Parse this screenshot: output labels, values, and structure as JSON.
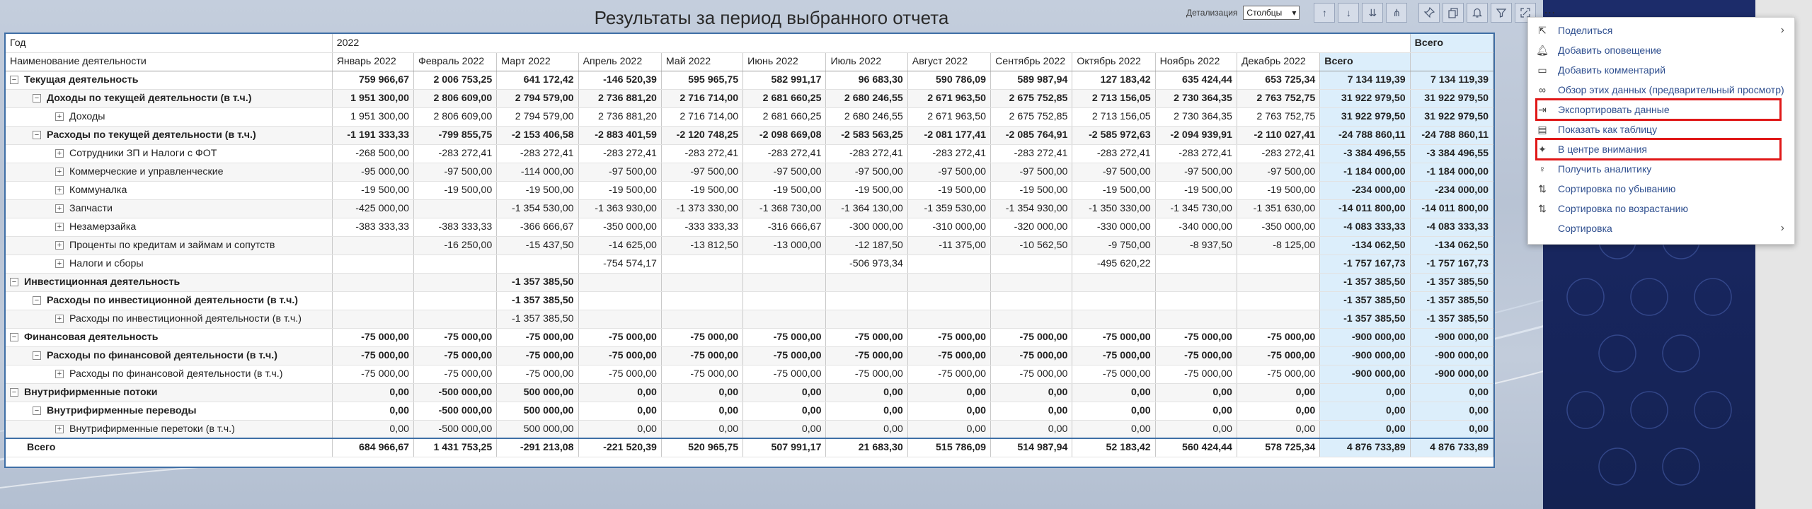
{
  "report": {
    "title": "Результаты за период выбранного отчета",
    "detail_label": "Детализация",
    "detail_value": "Столбцы"
  },
  "table": {
    "year_label": "Год",
    "year_value": "2022",
    "name_header": "Наименование деятельности",
    "total_header": "Всего",
    "total_header_outer": "Всего",
    "months": [
      "Январь 2022",
      "Февраль 2022",
      "Март 2022",
      "Апрель 2022",
      "Май 2022",
      "Июнь 2022",
      "Июль 2022",
      "Август 2022",
      "Сентябрь 2022",
      "Октябрь 2022",
      "Ноябрь 2022",
      "Декабрь 2022"
    ],
    "rows": [
      {
        "name": "Текущая деятельность",
        "level": 0,
        "bold": true,
        "toggle": "−",
        "values": [
          "759 966,67",
          "2 006 753,25",
          "641 172,42",
          "-146 520,39",
          "595 965,75",
          "582 991,17",
          "96 683,30",
          "590 786,09",
          "589 987,94",
          "127 183,42",
          "635 424,44",
          "653 725,34"
        ],
        "total": "7 134 119,39",
        "total2": "7 134 119,39"
      },
      {
        "name": "Доходы по текущей деятельности (в т.ч.)",
        "level": 1,
        "bold": true,
        "toggle": "−",
        "values": [
          "1 951 300,00",
          "2 806 609,00",
          "2 794 579,00",
          "2 736 881,20",
          "2 716 714,00",
          "2 681 660,25",
          "2 680 246,55",
          "2 671 963,50",
          "2 675 752,85",
          "2 713 156,05",
          "2 730 364,35",
          "2 763 752,75"
        ],
        "total": "31 922 979,50",
        "total2": "31 922 979,50"
      },
      {
        "name": "Доходы",
        "level": 2,
        "bold": false,
        "toggle": "+",
        "values": [
          "1 951 300,00",
          "2 806 609,00",
          "2 794 579,00",
          "2 736 881,20",
          "2 716 714,00",
          "2 681 660,25",
          "2 680 246,55",
          "2 671 963,50",
          "2 675 752,85",
          "2 713 156,05",
          "2 730 364,35",
          "2 763 752,75"
        ],
        "total": "31 922 979,50",
        "total2": "31 922 979,50"
      },
      {
        "name": "Расходы по текущей деятельности (в т.ч.)",
        "level": 1,
        "bold": true,
        "toggle": "−",
        "values": [
          "-1 191 333,33",
          "-799 855,75",
          "-2 153 406,58",
          "-2 883 401,59",
          "-2 120 748,25",
          "-2 098 669,08",
          "-2 583 563,25",
          "-2 081 177,41",
          "-2 085 764,91",
          "-2 585 972,63",
          "-2 094 939,91",
          "-2 110 027,41"
        ],
        "total": "-24 788 860,11",
        "total2": "-24 788 860,11"
      },
      {
        "name": "Сотрудники ЗП и Налоги с ФОТ",
        "level": 2,
        "bold": false,
        "toggle": "+",
        "values": [
          "-268 500,00",
          "-283 272,41",
          "-283 272,41",
          "-283 272,41",
          "-283 272,41",
          "-283 272,41",
          "-283 272,41",
          "-283 272,41",
          "-283 272,41",
          "-283 272,41",
          "-283 272,41",
          "-283 272,41"
        ],
        "total": "-3 384 496,55",
        "total2": "-3 384 496,55"
      },
      {
        "name": "Коммерческие и управленческие",
        "level": 2,
        "bold": false,
        "toggle": "+",
        "values": [
          "-95 000,00",
          "-97 500,00",
          "-114 000,00",
          "-97 500,00",
          "-97 500,00",
          "-97 500,00",
          "-97 500,00",
          "-97 500,00",
          "-97 500,00",
          "-97 500,00",
          "-97 500,00",
          "-97 500,00"
        ],
        "total": "-1 184 000,00",
        "total2": "-1 184 000,00"
      },
      {
        "name": "Коммуналка",
        "level": 2,
        "bold": false,
        "toggle": "+",
        "values": [
          "-19 500,00",
          "-19 500,00",
          "-19 500,00",
          "-19 500,00",
          "-19 500,00",
          "-19 500,00",
          "-19 500,00",
          "-19 500,00",
          "-19 500,00",
          "-19 500,00",
          "-19 500,00",
          "-19 500,00"
        ],
        "total": "-234 000,00",
        "total2": "-234 000,00"
      },
      {
        "name": "Запчасти",
        "level": 2,
        "bold": false,
        "toggle": "+",
        "values": [
          "-425 000,00",
          "",
          "-1 354 530,00",
          "-1 363 930,00",
          "-1 373 330,00",
          "-1 368 730,00",
          "-1 364 130,00",
          "-1 359 530,00",
          "-1 354 930,00",
          "-1 350 330,00",
          "-1 345 730,00",
          "-1 351 630,00"
        ],
        "total": "-14 011 800,00",
        "total2": "-14 011 800,00"
      },
      {
        "name": "Незамерзайка",
        "level": 2,
        "bold": false,
        "toggle": "+",
        "values": [
          "-383 333,33",
          "-383 333,33",
          "-366 666,67",
          "-350 000,00",
          "-333 333,33",
          "-316 666,67",
          "-300 000,00",
          "-310 000,00",
          "-320 000,00",
          "-330 000,00",
          "-340 000,00",
          "-350 000,00"
        ],
        "total": "-4 083 333,33",
        "total2": "-4 083 333,33"
      },
      {
        "name": "Проценты по кредитам и займам и сопутств",
        "level": 2,
        "bold": false,
        "toggle": "+",
        "values": [
          "",
          "-16 250,00",
          "-15 437,50",
          "-14 625,00",
          "-13 812,50",
          "-13 000,00",
          "-12 187,50",
          "-11 375,00",
          "-10 562,50",
          "-9 750,00",
          "-8 937,50",
          "-8 125,00"
        ],
        "total": "-134 062,50",
        "total2": "-134 062,50"
      },
      {
        "name": "Налоги и сборы",
        "level": 2,
        "bold": false,
        "toggle": "+",
        "values": [
          "",
          "",
          "",
          "-754 574,17",
          "",
          "",
          "-506 973,34",
          "",
          "",
          "-495 620,22",
          "",
          ""
        ],
        "total": "-1 757 167,73",
        "total2": "-1 757 167,73"
      },
      {
        "name": "Инвестиционная деятельность",
        "level": 0,
        "bold": true,
        "toggle": "−",
        "values": [
          "",
          "",
          "-1 357 385,50",
          "",
          "",
          "",
          "",
          "",
          "",
          "",
          "",
          ""
        ],
        "total": "-1 357 385,50",
        "total2": "-1 357 385,50"
      },
      {
        "name": "Расходы по инвестиционной деятельности (в т.ч.)",
        "level": 1,
        "bold": true,
        "toggle": "−",
        "values": [
          "",
          "",
          "-1 357 385,50",
          "",
          "",
          "",
          "",
          "",
          "",
          "",
          "",
          ""
        ],
        "total": "-1 357 385,50",
        "total2": "-1 357 385,50"
      },
      {
        "name": "Расходы по инвестиционной деятельности (в т.ч.)",
        "level": 2,
        "bold": false,
        "toggle": "+",
        "values": [
          "",
          "",
          "-1 357 385,50",
          "",
          "",
          "",
          "",
          "",
          "",
          "",
          "",
          ""
        ],
        "total": "-1 357 385,50",
        "total2": "-1 357 385,50"
      },
      {
        "name": "Финансовая деятельность",
        "level": 0,
        "bold": true,
        "toggle": "−",
        "values": [
          "-75 000,00",
          "-75 000,00",
          "-75 000,00",
          "-75 000,00",
          "-75 000,00",
          "-75 000,00",
          "-75 000,00",
          "-75 000,00",
          "-75 000,00",
          "-75 000,00",
          "-75 000,00",
          "-75 000,00"
        ],
        "total": "-900 000,00",
        "total2": "-900 000,00"
      },
      {
        "name": "Расходы по финансовой деятельности (в т.ч.)",
        "level": 1,
        "bold": true,
        "toggle": "−",
        "values": [
          "-75 000,00",
          "-75 000,00",
          "-75 000,00",
          "-75 000,00",
          "-75 000,00",
          "-75 000,00",
          "-75 000,00",
          "-75 000,00",
          "-75 000,00",
          "-75 000,00",
          "-75 000,00",
          "-75 000,00"
        ],
        "total": "-900 000,00",
        "total2": "-900 000,00"
      },
      {
        "name": "Расходы по финансовой деятельности (в т.ч.)",
        "level": 2,
        "bold": false,
        "toggle": "+",
        "values": [
          "-75 000,00",
          "-75 000,00",
          "-75 000,00",
          "-75 000,00",
          "-75 000,00",
          "-75 000,00",
          "-75 000,00",
          "-75 000,00",
          "-75 000,00",
          "-75 000,00",
          "-75 000,00",
          "-75 000,00"
        ],
        "total": "-900 000,00",
        "total2": "-900 000,00"
      },
      {
        "name": "Внутрифирменные потоки",
        "level": 0,
        "bold": true,
        "toggle": "−",
        "values": [
          "0,00",
          "-500 000,00",
          "500 000,00",
          "0,00",
          "0,00",
          "0,00",
          "0,00",
          "0,00",
          "0,00",
          "0,00",
          "0,00",
          "0,00"
        ],
        "total": "0,00",
        "total2": "0,00"
      },
      {
        "name": "Внутрифирменные переводы",
        "level": 1,
        "bold": true,
        "toggle": "−",
        "values": [
          "0,00",
          "-500 000,00",
          "500 000,00",
          "0,00",
          "0,00",
          "0,00",
          "0,00",
          "0,00",
          "0,00",
          "0,00",
          "0,00",
          "0,00"
        ],
        "total": "0,00",
        "total2": "0,00"
      },
      {
        "name": "Внутрифирменные перетоки (в т.ч.)",
        "level": 2,
        "bold": false,
        "toggle": "+",
        "values": [
          "0,00",
          "-500 000,00",
          "500 000,00",
          "0,00",
          "0,00",
          "0,00",
          "0,00",
          "0,00",
          "0,00",
          "0,00",
          "0,00",
          "0,00"
        ],
        "total": "0,00",
        "total2": "0,00"
      }
    ],
    "grand_total": {
      "name": "Всего",
      "values": [
        "684 966,67",
        "1 431 753,25",
        "-291 213,08",
        "-221 520,39",
        "520 965,75",
        "507 991,17",
        "21 683,30",
        "515 786,09",
        "514 987,94",
        "52 183,42",
        "560 424,44",
        "578 725,34"
      ],
      "total": "4 876 733,89",
      "total2": "4 876 733,89"
    }
  },
  "menu": {
    "items": [
      {
        "label": "Поделиться",
        "icon": "share-icon",
        "submenu": true
      },
      {
        "label": "Добавить оповещение",
        "icon": "bell-icon",
        "submenu": false
      },
      {
        "label": "Добавить комментарий",
        "icon": "comment-icon",
        "submenu": false
      },
      {
        "label": "Обзор этих данных (предварительный просмотр)",
        "icon": "binoculars-icon",
        "submenu": false
      },
      {
        "label": "Экспортировать данные",
        "icon": "export-icon",
        "submenu": false,
        "highlight": true
      },
      {
        "label": "Показать как таблицу",
        "icon": "table-icon",
        "submenu": false
      },
      {
        "label": "В центре внимания",
        "icon": "spotlight-icon",
        "submenu": false,
        "highlight": true
      },
      {
        "label": "Получить аналитику",
        "icon": "lightbulb-icon",
        "submenu": false
      },
      {
        "label": "Сортировка по убыванию",
        "icon": "sort-desc-icon",
        "submenu": false
      },
      {
        "label": "Сортировка по возрастанию",
        "icon": "sort-asc-icon",
        "submenu": false
      },
      {
        "label": "Сортировка",
        "icon": "",
        "submenu": true
      }
    ]
  },
  "colors": {
    "highlight": "#e01818",
    "menu_text": "#2f4f8f",
    "total_bg": "#dceefb",
    "table_border": "#3f6fa6"
  }
}
